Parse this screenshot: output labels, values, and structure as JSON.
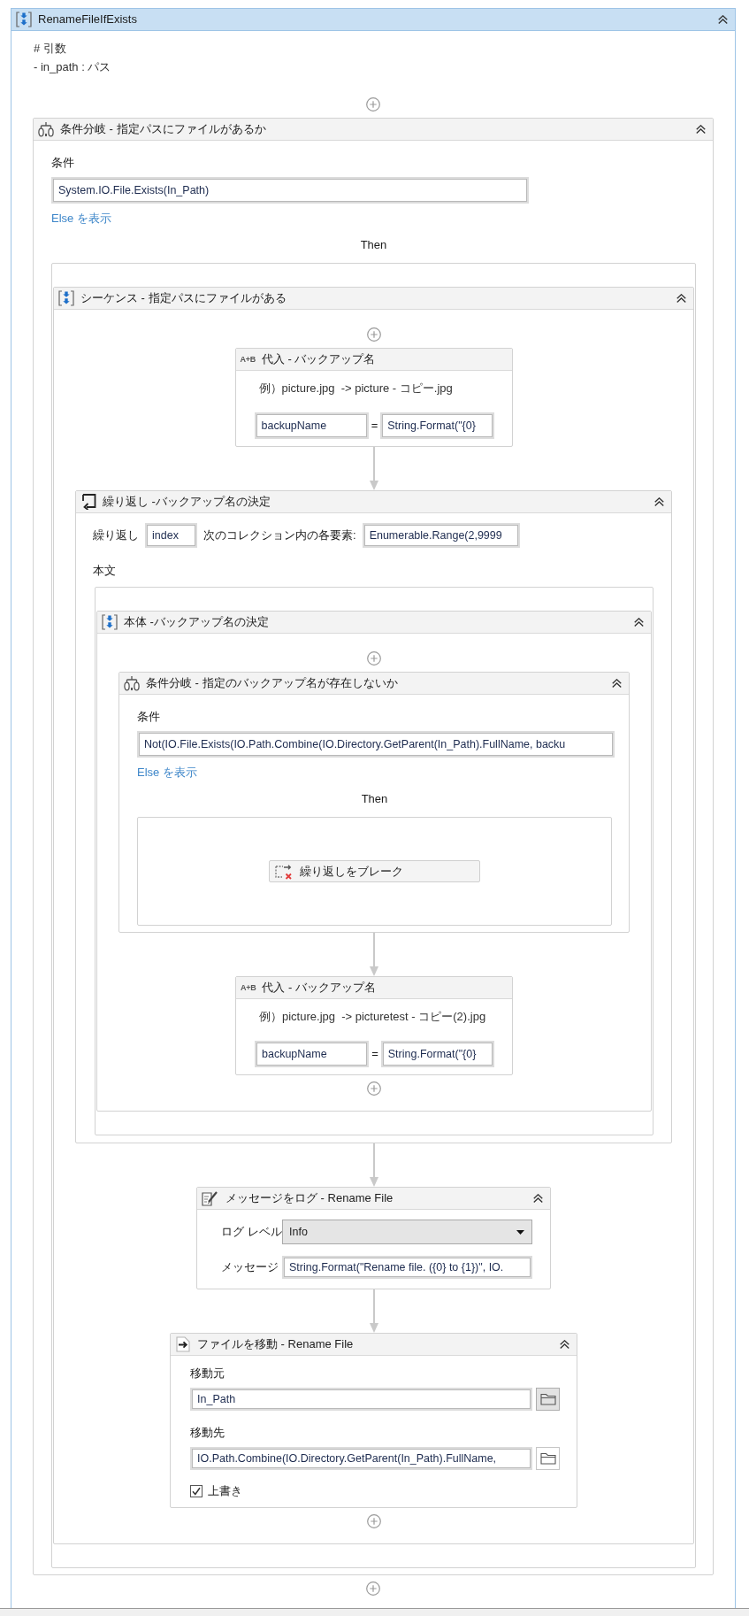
{
  "workflow": {
    "kind": "sequence",
    "title": "RenameFileIfExists",
    "selected": true,
    "annotation": [
      "# 引数",
      "- in_path : パス"
    ],
    "children": [
      {
        "kind": "if",
        "title": "条件分岐 - 指定パスにファイルがあるか",
        "selected": false,
        "condition_label": "条件",
        "condition": "System.IO.File.Exists(In_Path)",
        "else_link": "Else を表示",
        "then_label": "Then",
        "then": [
          {
            "kind": "sequence",
            "title": "シーケンス - 指定パスにファイルがある",
            "selected": false,
            "children": [
              {
                "kind": "assign",
                "icon_label": "A+B",
                "title": "代入 - バックアップ名",
                "selected": false,
                "annotation": "例）picture.jpg  -> picture - コピー.jpg",
                "to": "backupName",
                "operator": "=",
                "value": "String.Format(\"{0}"
              },
              {
                "kind": "foreach",
                "title": "繰り返し -バックアップ名の決定",
                "selected": false,
                "loop_label": "繰り返し",
                "item": "index",
                "in_label": "次のコレクション内の各要素:",
                "values": "Enumerable.Range(2,9999",
                "body_label": "本文",
                "body": [
                  {
                    "kind": "sequence",
                    "title": "本体 -バックアップ名の決定",
                    "selected": false,
                    "children": [
                      {
                        "kind": "if",
                        "title": "条件分岐 - 指定のバックアップ名が存在しないか",
                        "selected": false,
                        "condition_label": "条件",
                        "condition": "Not(IO.File.Exists(IO.Path.Combine(IO.Directory.GetParent(In_Path).FullName, backu",
                        "else_link": "Else を表示",
                        "then_label": "Then",
                        "then": [
                          {
                            "kind": "break",
                            "title": "繰り返しをブレーク",
                            "selected": false
                          }
                        ]
                      },
                      {
                        "kind": "assign",
                        "icon_label": "A+B",
                        "title": "代入 - バックアップ名",
                        "selected": false,
                        "annotation": "例）picture.jpg  -> picturetest - コピー(2).jpg",
                        "to": "backupName",
                        "operator": "=",
                        "value": "String.Format(\"{0}"
                      }
                    ]
                  }
                ]
              },
              {
                "kind": "log",
                "title": "メッセージをログ - Rename File",
                "selected": false,
                "level_label": "ログ レベル",
                "level": "Info",
                "message_label": "メッセージ",
                "message": "String.Format(\"Rename file. ({0} to {1})\", IO."
              },
              {
                "kind": "move_file",
                "title": "ファイルを移動 - Rename File",
                "selected": false,
                "fields": [
                  {
                    "label": "移動元",
                    "value": "In_Path",
                    "browse_hovered": true
                  },
                  {
                    "label": "移動先",
                    "value": "IO.Path.Combine(IO.Directory.GetParent(In_Path).FullName,",
                    "browse_hovered": false
                  }
                ],
                "overwrite_label": "上書き",
                "overwrite": true
              }
            ]
          }
        ]
      }
    ]
  }
}
